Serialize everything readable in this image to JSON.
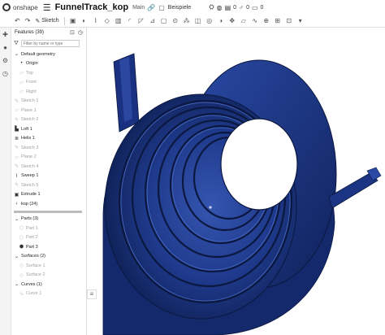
{
  "header": {
    "brand": "onshape",
    "document_title": "FunnelTrack_kop",
    "workspace": "Main",
    "folder": "Beispiele",
    "versions_count": "0",
    "likes_count": "0",
    "comments_count": "0"
  },
  "toolbar": {
    "sketch_label": "Sketch"
  },
  "panel": {
    "title": "Features (39)",
    "filter_placeholder": "Filter by name or type"
  },
  "tree": {
    "default_geometry": "Default geometry",
    "origin": "Origin",
    "top": "Top",
    "front": "Front",
    "right": "Right",
    "features": [
      {
        "label": "Sketch 1",
        "kind": "sketch"
      },
      {
        "label": "Plane 1",
        "kind": "plane"
      },
      {
        "label": "Sketch 2",
        "kind": "sketch"
      },
      {
        "label": "Loft 1",
        "kind": "loft"
      },
      {
        "label": "Helix 1",
        "kind": "helix"
      },
      {
        "label": "Sketch 3",
        "kind": "sketch"
      },
      {
        "label": "Plane 2",
        "kind": "plane"
      },
      {
        "label": "Sketch 4",
        "kind": "sketch"
      },
      {
        "label": "Sweep 1",
        "kind": "sweep"
      },
      {
        "label": "Sketch 5",
        "kind": "sketch"
      },
      {
        "label": "Extrude 1",
        "kind": "extrude"
      },
      {
        "label": "kop (24)",
        "kind": "folder"
      }
    ],
    "parts_header": "Parts (3)",
    "parts": [
      "Part 1",
      "Part 2",
      "Part 3"
    ],
    "surfaces_header": "Surfaces (2)",
    "surfaces": [
      "Surface 1",
      "Surface 2"
    ],
    "curves_header": "Curves (1)",
    "curves": [
      "Curve 1"
    ]
  },
  "colors": {
    "model_dark": "#0d1d4e",
    "model_mid": "#1f3a8c",
    "model_light": "#3555b0"
  }
}
